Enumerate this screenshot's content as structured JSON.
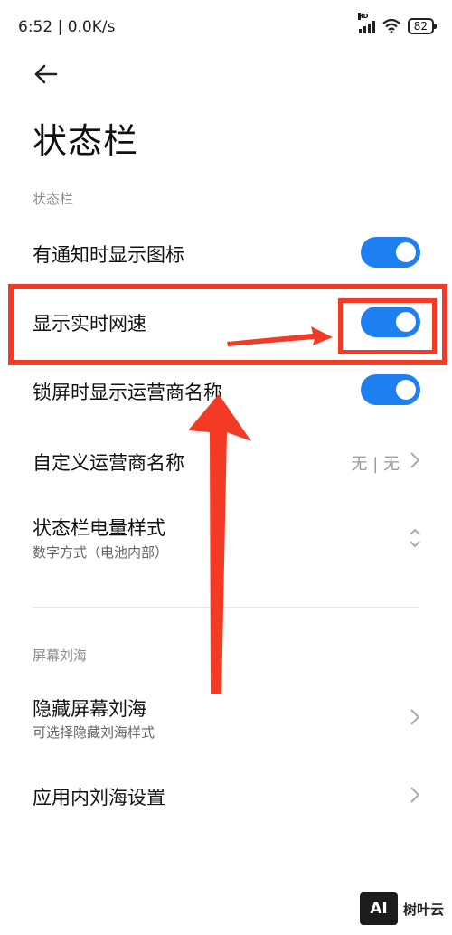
{
  "status_bar": {
    "time": "6:52 | 0.0K/s",
    "signal_tag": "HD",
    "battery": "82"
  },
  "page": {
    "title": "状态栏"
  },
  "sections": [
    {
      "label": "状态栏"
    },
    {
      "label": "屏幕刘海"
    }
  ],
  "rows": {
    "notify_icons": {
      "label": "有通知时显示图标",
      "on": true
    },
    "net_speed": {
      "label": "显示实时网速",
      "on": true
    },
    "lock_carrier": {
      "label": "锁屏时显示运营商名称",
      "on": true
    },
    "custom_carrier": {
      "label": "自定义运营商名称",
      "value": "无 | 无"
    },
    "battery_style": {
      "label": "状态栏电量样式",
      "sub": "数字方式（电池内部）"
    },
    "hide_notch": {
      "label": "隐藏屏幕刘海",
      "sub": "可选择隐藏刘海样式"
    },
    "app_notch": {
      "label": "应用内刘海设置"
    }
  },
  "colors": {
    "toggle_on": "#1e7ff0",
    "annotation": "#f23a25"
  },
  "watermark": {
    "logo": "AI",
    "text": "树叶云"
  }
}
